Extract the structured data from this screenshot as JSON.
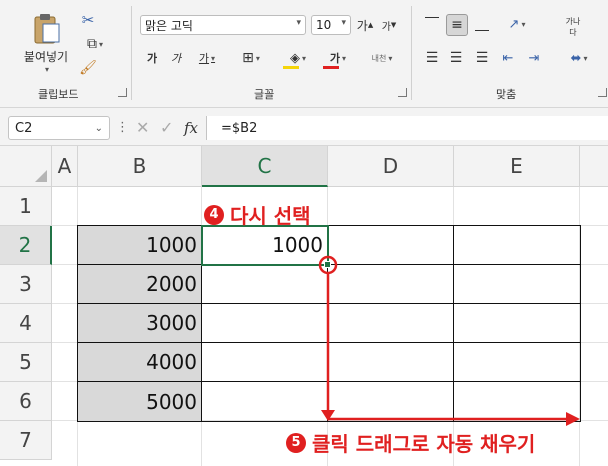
{
  "ribbon": {
    "clipboard": {
      "paste_label": "붙여넣기",
      "group_label": "클립보드"
    },
    "font": {
      "font_name": "맑은 고딕",
      "font_size": "10",
      "grow_label": "가",
      "shrink_label": "가",
      "bold_label": "가",
      "italic_label": "가",
      "underline_label": "가",
      "fontcolor_label": "가",
      "phonetic_label": "내천",
      "group_label": "글꼴",
      "fill_color": "#f5d50a",
      "font_color": "#e02020"
    },
    "alignment": {
      "wrap_label": "가나\n다",
      "group_label": "맞춤"
    }
  },
  "formula_bar": {
    "cell_ref": "C2",
    "fx_label": "fx",
    "formula": "=$B2"
  },
  "sheet": {
    "columns": [
      "A",
      "B",
      "C",
      "D",
      "E"
    ],
    "rows": [
      "1",
      "2",
      "3",
      "4",
      "5",
      "6",
      "7"
    ],
    "b_values": [
      "1000",
      "2000",
      "3000",
      "4000",
      "5000"
    ],
    "c2_value": "1000",
    "selected_cell": "C2",
    "accent_color": "#217346"
  },
  "annotations": {
    "step4_number": "4",
    "step4_text": "다시 선택",
    "step5_number": "5",
    "step5_text": "클릭 드래그로 자동 채우기",
    "color": "#e02020"
  }
}
